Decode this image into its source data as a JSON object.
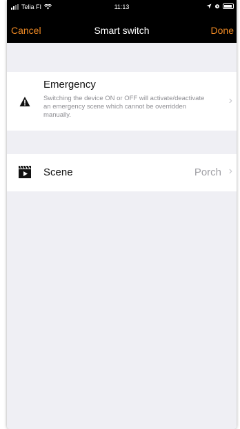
{
  "status_bar": {
    "carrier": "Telia FI",
    "time": "11:13"
  },
  "nav": {
    "cancel_label": "Cancel",
    "title": "Smart switch",
    "done_label": "Done"
  },
  "emergency": {
    "title": "Emergency",
    "description": "Switching the device ON or OFF will activate/deactivate an emergency scene which cannot be overridden manually.",
    "icon": "warning-icon"
  },
  "scene": {
    "label": "Scene",
    "value": "Porch",
    "icon": "clapperboard-icon"
  },
  "colors": {
    "accent": "#f08a24",
    "background": "#efeff4",
    "navbar": "#000000"
  }
}
